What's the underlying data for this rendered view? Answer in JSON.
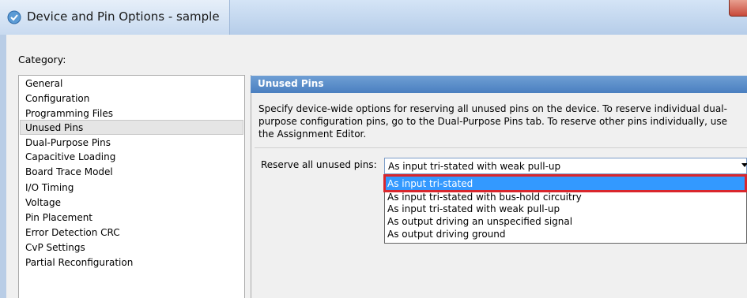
{
  "window": {
    "title": "Device and Pin Options - sample"
  },
  "category": {
    "label": "Category:",
    "items": [
      "General",
      "Configuration",
      "Programming Files",
      "Unused Pins",
      "Dual-Purpose Pins",
      "Capacitive Loading",
      "Board Trace Model",
      "I/O Timing",
      "Voltage",
      "Pin Placement",
      "Error Detection CRC",
      "CvP Settings",
      "Partial Reconfiguration"
    ],
    "selected": "Unused Pins"
  },
  "panel": {
    "header": "Unused Pins",
    "description_lines": [
      "Specify device-wide options for reserving all unused pins on the device. To reserve individual dual-",
      "purpose configuration pins, go to the Dual-Purpose Pins tab. To reserve other pins individually, use",
      "the Assignment Editor."
    ],
    "reserve_label": "Reserve all unused pins:",
    "reserve_value": "As input tri-stated with weak pull-up",
    "options": [
      "As input tri-stated",
      "As input tri-stated with bus-hold circuitry",
      "As input tri-stated with weak pull-up",
      "As output driving an unspecified signal",
      "As output driving ground"
    ],
    "highlighted_option": "As input tri-stated"
  },
  "colors": {
    "header": "#4a7fc0",
    "selection": "#3399ff",
    "annotation": "#d9262c"
  }
}
